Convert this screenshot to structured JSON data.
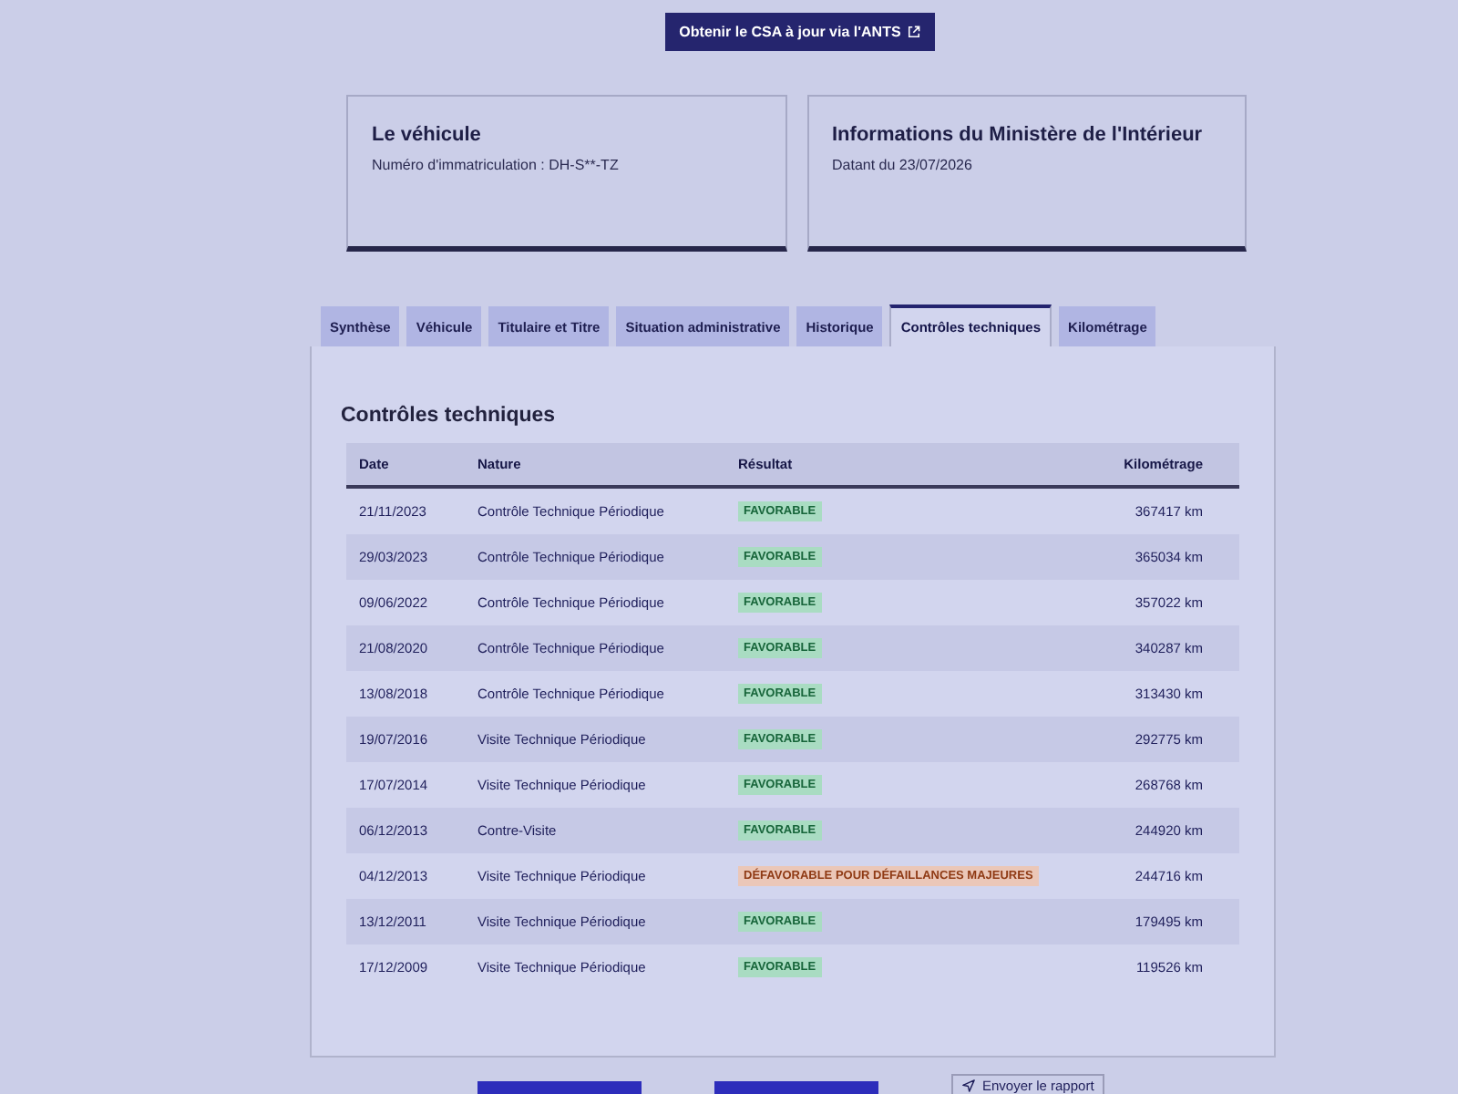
{
  "top_button": {
    "label": "Obtenir le CSA à jour via l'ANTS"
  },
  "cards": [
    {
      "title": "Le véhicule",
      "text": "Numéro d'immatriculation : DH-S**-TZ"
    },
    {
      "title": "Informations du Ministère de l'Intérieur",
      "text": "Datant du 23/07/2026"
    }
  ],
  "tabs": [
    {
      "label": "Synthèse",
      "selected": false
    },
    {
      "label": "Véhicule",
      "selected": false
    },
    {
      "label": "Titulaire et Titre",
      "selected": false
    },
    {
      "label": "Situation administrative",
      "selected": false
    },
    {
      "label": "Historique",
      "selected": false
    },
    {
      "label": "Contrôles techniques",
      "selected": true
    },
    {
      "label": "Kilométrage",
      "selected": false
    }
  ],
  "section": {
    "title": "Contrôles techniques",
    "table": {
      "columns": [
        "Date",
        "Nature",
        "Résultat",
        "Kilométrage"
      ],
      "rows": [
        {
          "date": "21/11/2023",
          "nature": "Contrôle Technique Périodique",
          "result": {
            "label": "FAVORABLE",
            "kind": "favorable"
          },
          "mileage": "367417 km"
        },
        {
          "date": "29/03/2023",
          "nature": "Contrôle Technique Périodique",
          "result": {
            "label": "FAVORABLE",
            "kind": "favorable"
          },
          "mileage": "365034 km"
        },
        {
          "date": "09/06/2022",
          "nature": "Contrôle Technique Périodique",
          "result": {
            "label": "FAVORABLE",
            "kind": "favorable"
          },
          "mileage": "357022 km"
        },
        {
          "date": "21/08/2020",
          "nature": "Contrôle Technique Périodique",
          "result": {
            "label": "FAVORABLE",
            "kind": "favorable"
          },
          "mileage": "340287 km"
        },
        {
          "date": "13/08/2018",
          "nature": "Contrôle Technique Périodique",
          "result": {
            "label": "FAVORABLE",
            "kind": "favorable"
          },
          "mileage": "313430 km"
        },
        {
          "date": "19/07/2016",
          "nature": "Visite Technique Périodique",
          "result": {
            "label": "FAVORABLE",
            "kind": "favorable"
          },
          "mileage": "292775 km"
        },
        {
          "date": "17/07/2014",
          "nature": "Visite Technique Périodique",
          "result": {
            "label": "FAVORABLE",
            "kind": "favorable"
          },
          "mileage": "268768 km"
        },
        {
          "date": "06/12/2013",
          "nature": "Contre-Visite",
          "result": {
            "label": "FAVORABLE",
            "kind": "favorable"
          },
          "mileage": "244920 km"
        },
        {
          "date": "04/12/2013",
          "nature": "Visite Technique Périodique",
          "result": {
            "label": "DÉFAVORABLE POUR DÉFAILLANCES MAJEURES",
            "kind": "defavorable"
          },
          "mileage": "244716 km"
        },
        {
          "date": "13/12/2011",
          "nature": "Visite Technique Périodique",
          "result": {
            "label": "FAVORABLE",
            "kind": "favorable"
          },
          "mileage": "179495 km"
        },
        {
          "date": "17/12/2009",
          "nature": "Visite Technique Périodique",
          "result": {
            "label": "FAVORABLE",
            "kind": "favorable"
          },
          "mileage": "119526 km"
        }
      ]
    }
  },
  "footer_buttons": [
    {
      "kind": "primary"
    },
    {
      "kind": "primary"
    },
    {
      "kind": "secondary",
      "label": "Envoyer le rapport"
    }
  ]
}
